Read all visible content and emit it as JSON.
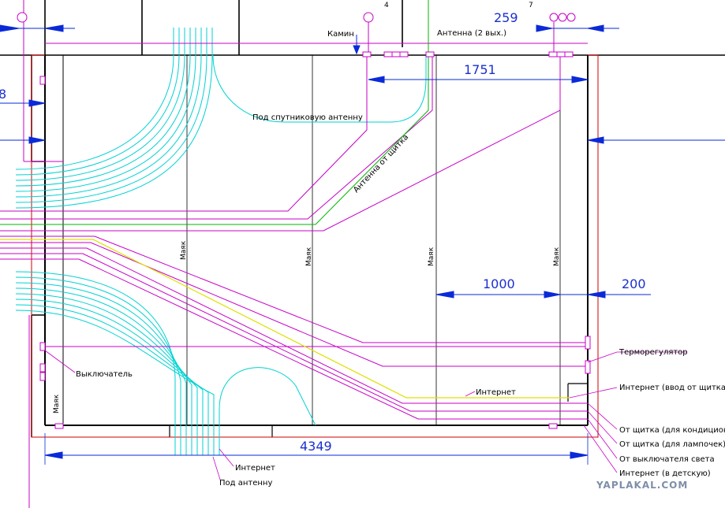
{
  "labels": {
    "fireplace": "Камин",
    "antenna_two_out": "Антенна (2 вых.)",
    "satellite": "Под спутниковую антенну",
    "antenna_from_panel": "Антенна от щитка",
    "switch": "Выключатель",
    "thermostat": "Терморегулятор",
    "internet_mid": "Интернет",
    "internet_input": "Интернет (ввод от щитка)",
    "from_panel_ac": "От щитка (для кондиционе",
    "from_panel_lamps": "От щитка (для лампочек)",
    "from_light_switch": "От выключателя света",
    "internet_child": "Интернет (в детскую)",
    "internet_bottom": "Интернет",
    "for_antenna": "Под антенну",
    "beacon": "Маяк"
  },
  "dimensions": {
    "d259": "259",
    "d1751": "1751",
    "d1000": "1000",
    "d200": "200",
    "d4349": "4349",
    "d_left": "8"
  },
  "markers": {
    "m4": "4",
    "m7": "7"
  },
  "watermark": "YAPLAKAL.COM",
  "colors": {
    "cyan": "#00d2d2",
    "magenta": "#c800c8",
    "green": "#00b400",
    "yellow": "#e0e000",
    "blue": "#0a2ad8",
    "red": "#d00000"
  }
}
